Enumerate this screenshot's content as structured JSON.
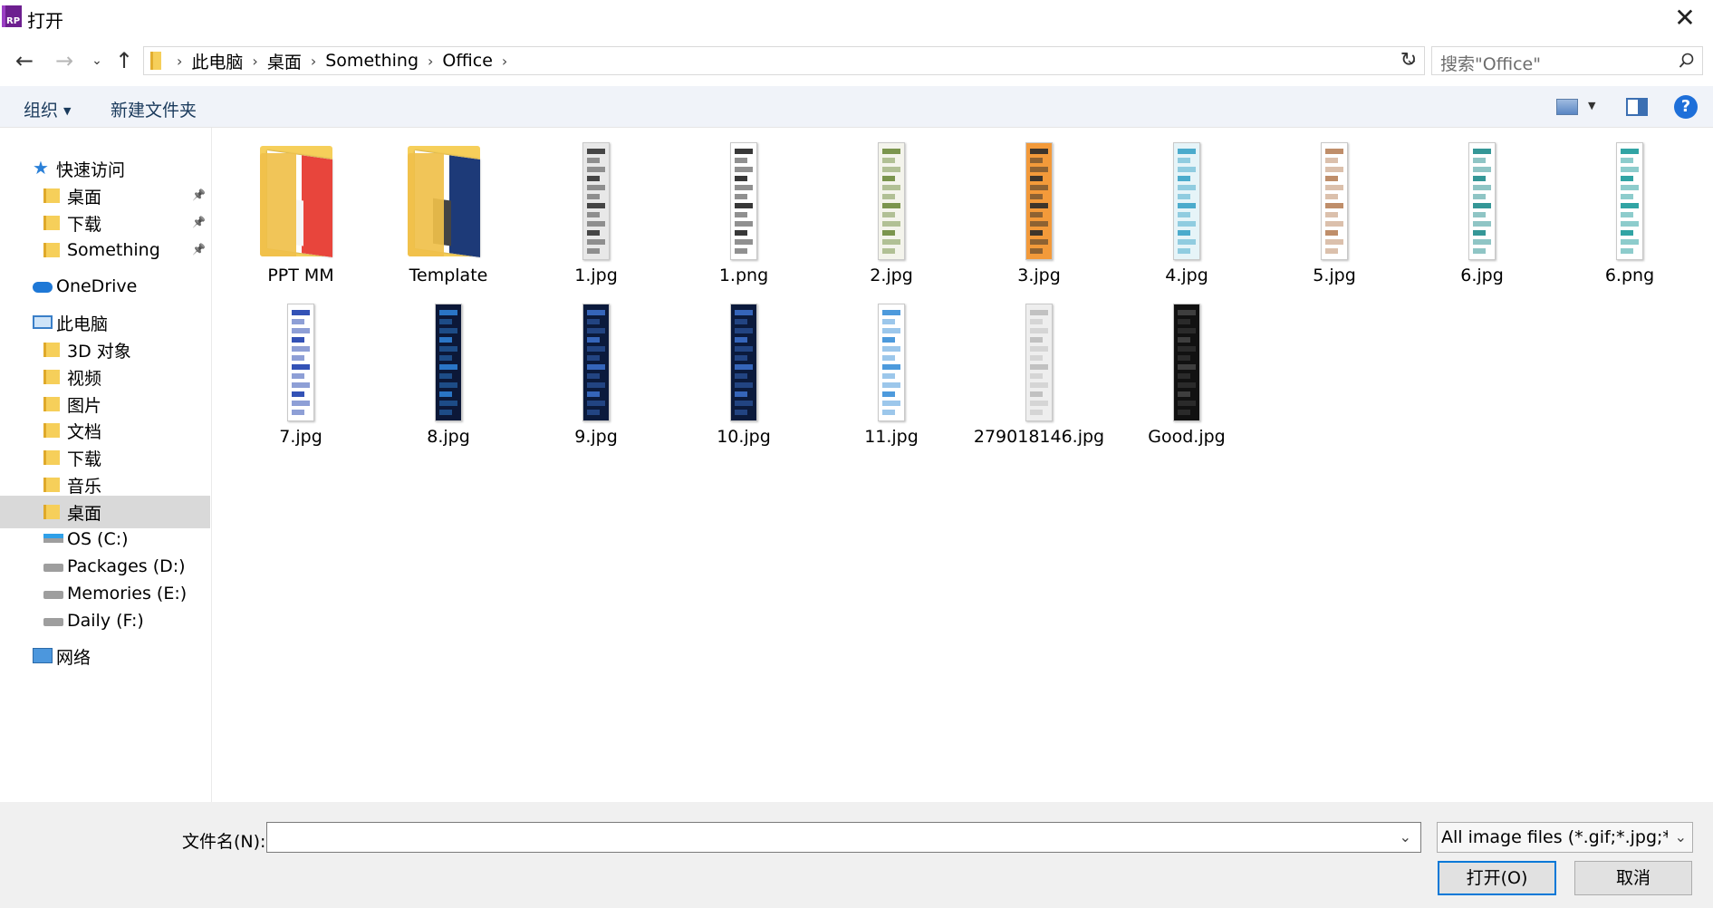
{
  "window": {
    "title": "打开",
    "app_badge": "RP"
  },
  "breadcrumb": [
    "此电脑",
    "桌面",
    "Something",
    "Office"
  ],
  "search": {
    "placeholder": "搜索\"Office\""
  },
  "toolbar": {
    "organize_label": "组织",
    "new_folder_label": "新建文件夹"
  },
  "sidebar": {
    "items": [
      {
        "label": "快速访问",
        "icon": "star-icon",
        "level": 0,
        "pinned": false,
        "selected": false
      },
      {
        "label": "桌面",
        "icon": "folder-icon",
        "level": 1,
        "pinned": true,
        "selected": false
      },
      {
        "label": "下载",
        "icon": "download-folder-icon",
        "level": 1,
        "pinned": true,
        "selected": false
      },
      {
        "label": "Something",
        "icon": "folder-icon",
        "level": 1,
        "pinned": true,
        "selected": false
      },
      {
        "label": "OneDrive",
        "icon": "cloud-icon",
        "level": 0,
        "pinned": false,
        "selected": false
      },
      {
        "label": "此电脑",
        "icon": "computer-icon",
        "level": 0,
        "pinned": false,
        "selected": false
      },
      {
        "label": "3D 对象",
        "icon": "3d-objects-icon",
        "level": 1,
        "pinned": false,
        "selected": false
      },
      {
        "label": "视频",
        "icon": "video-folder-icon",
        "level": 1,
        "pinned": false,
        "selected": false
      },
      {
        "label": "图片",
        "icon": "pictures-folder-icon",
        "level": 1,
        "pinned": false,
        "selected": false
      },
      {
        "label": "文档",
        "icon": "documents-folder-icon",
        "level": 1,
        "pinned": false,
        "selected": false
      },
      {
        "label": "下载",
        "icon": "download-folder-icon",
        "level": 1,
        "pinned": false,
        "selected": false
      },
      {
        "label": "音乐",
        "icon": "music-folder-icon",
        "level": 1,
        "pinned": false,
        "selected": false
      },
      {
        "label": "桌面",
        "icon": "desktop-folder-icon",
        "level": 1,
        "pinned": false,
        "selected": true
      },
      {
        "label": "OS (C:)",
        "icon": "os-drive-icon",
        "level": 1,
        "pinned": false,
        "selected": false
      },
      {
        "label": "Packages (D:)",
        "icon": "drive-icon",
        "level": 1,
        "pinned": false,
        "selected": false
      },
      {
        "label": "Memories (E:)",
        "icon": "drive-icon",
        "level": 1,
        "pinned": false,
        "selected": false
      },
      {
        "label": "Daily (F:)",
        "icon": "drive-icon",
        "level": 1,
        "pinned": false,
        "selected": false
      },
      {
        "label": "网络",
        "icon": "network-icon",
        "level": 0,
        "pinned": false,
        "selected": false
      }
    ]
  },
  "files": [
    {
      "name": "PPT MM",
      "kind": "folder",
      "colors": [
        "#e8453c",
        "#f6f6f6"
      ]
    },
    {
      "name": "Template",
      "kind": "folder",
      "colors": [
        "#1d3a78",
        "#444444"
      ]
    },
    {
      "name": "1.jpg",
      "kind": "image",
      "colors": [
        "#e8e8e8",
        "#333333"
      ]
    },
    {
      "name": "1.png",
      "kind": "image",
      "colors": [
        "#ffffff",
        "#222222"
      ]
    },
    {
      "name": "2.jpg",
      "kind": "image",
      "colors": [
        "#f4f4ec",
        "#6e8b3d"
      ]
    },
    {
      "name": "3.jpg",
      "kind": "image",
      "colors": [
        "#f39a3a",
        "#2a2a2a"
      ]
    },
    {
      "name": "4.jpg",
      "kind": "image",
      "colors": [
        "#e6f4f8",
        "#3aa3c7"
      ]
    },
    {
      "name": "5.jpg",
      "kind": "image",
      "colors": [
        "#ffffff",
        "#b8825a"
      ]
    },
    {
      "name": "6.jpg",
      "kind": "image",
      "colors": [
        "#ffffff",
        "#1f8c8c"
      ]
    },
    {
      "name": "6.png",
      "kind": "image",
      "colors": [
        "#ffffff",
        "#1b9a9a"
      ]
    },
    {
      "name": "7.jpg",
      "kind": "image",
      "colors": [
        "#ffffff",
        "#1d3fae"
      ]
    },
    {
      "name": "8.jpg",
      "kind": "image",
      "colors": [
        "#0c1838",
        "#2e7fd6"
      ]
    },
    {
      "name": "9.jpg",
      "kind": "image",
      "colors": [
        "#0b1a3c",
        "#3a6ec8"
      ]
    },
    {
      "name": "10.jpg",
      "kind": "image",
      "colors": [
        "#0b1a3c",
        "#3a6ec8"
      ]
    },
    {
      "name": "11.jpg",
      "kind": "image",
      "colors": [
        "#ffffff",
        "#3a8fd8"
      ]
    },
    {
      "name": "279018146.jpg",
      "kind": "image",
      "colors": [
        "#eeeeee",
        "#bbbbbb"
      ]
    },
    {
      "name": "Good.jpg",
      "kind": "image",
      "colors": [
        "#111111",
        "#444444"
      ]
    }
  ],
  "footer": {
    "filename_label": "文件名(N):",
    "filename_value": "",
    "filter_value": "All image files (*.gif;*.jpg;*.jpg",
    "open_label": "打开(O)",
    "cancel_label": "取消"
  },
  "colors": {
    "accent": "#0078d7",
    "selected_bg": "#d9d9d9",
    "toolbar_bg": "#f0f3f9"
  }
}
